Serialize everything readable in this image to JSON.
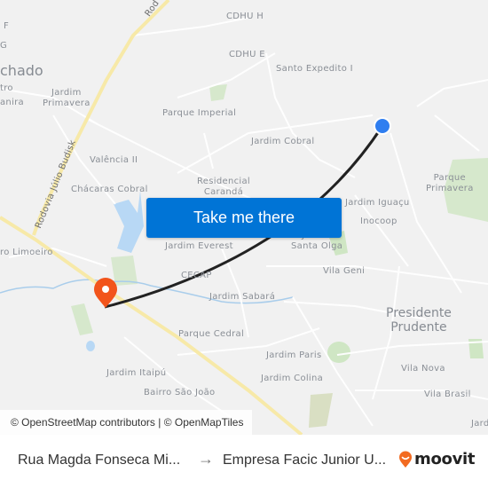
{
  "map": {
    "labels": [
      {
        "id": "cdhu-h",
        "text": "CDHU H"
      },
      {
        "id": "cdhu-e",
        "text": "CDHU E"
      },
      {
        "id": "santo-expedito",
        "text": "Santo Expedito I"
      },
      {
        "id": "machado",
        "text": "chado"
      },
      {
        "id": "f",
        "text": "F"
      },
      {
        "id": "g",
        "text": "G"
      },
      {
        "id": "tro",
        "text": "tro"
      },
      {
        "id": "anira",
        "text": "anira"
      },
      {
        "id": "jardim-primavera",
        "text": "Jardim\nPrimavera"
      },
      {
        "id": "parque-imperial",
        "text": "Parque Imperial"
      },
      {
        "id": "jardim-cobral",
        "text": "Jardim Cobral"
      },
      {
        "id": "valencia",
        "text": "Valência II"
      },
      {
        "id": "residencial-caranda",
        "text": "Residencial\nCarandá"
      },
      {
        "id": "chacaras-cobral",
        "text": "Chácaras Cobral"
      },
      {
        "id": "parque-primavera",
        "text": "Parque\nPrimavera"
      },
      {
        "id": "jardim-iguacu",
        "text": "Jardim Iguaçu"
      },
      {
        "id": "inocoop",
        "text": "Inocoop"
      },
      {
        "id": "jardim-santa-olga",
        "text": "Jardim\nSanta Olga"
      },
      {
        "id": "jardim-everest",
        "text": "Jardim Everest"
      },
      {
        "id": "limoeiro",
        "text": "ro Limoeiro"
      },
      {
        "id": "cecap",
        "text": "CECAP"
      },
      {
        "id": "vila-geni",
        "text": "Vila Geni"
      },
      {
        "id": "jardim-sabara",
        "text": "Jardim Sabará"
      },
      {
        "id": "presidente-prudente",
        "text": "Presidente\nPrudente"
      },
      {
        "id": "parque-cedral",
        "text": "Parque Cedral"
      },
      {
        "id": "jardim-paris",
        "text": "Jardim Paris"
      },
      {
        "id": "vila-nova",
        "text": "Vila Nova"
      },
      {
        "id": "jardim-itaipu",
        "text": "Jardim Itaipú"
      },
      {
        "id": "jardim-colina",
        "text": "Jardim Colina"
      },
      {
        "id": "bairro-sao-joao",
        "text": "Bairro São João"
      },
      {
        "id": "vila-brasil",
        "text": "Vila Brasil"
      },
      {
        "id": "jard",
        "text": "Jard"
      },
      {
        "id": "rodovia-julio-budisk",
        "text": "Rodovia Júlio Budisk"
      },
      {
        "id": "rod",
        "text": "Rod"
      }
    ],
    "origin_marker": {
      "color": "#2f7ef0"
    },
    "destination_marker": {
      "color": "#f2541b"
    },
    "route_color": "#222222",
    "cta_label": "Take me there",
    "attribution": "© OpenStreetMap contributors | © OpenMapTiles"
  },
  "footer": {
    "origin": "Rua Magda Fonseca Mi...",
    "arrow": "→",
    "destination": "Empresa Facic Junior U...",
    "logo_text": "moovit",
    "brand_color": "#f26b21"
  }
}
